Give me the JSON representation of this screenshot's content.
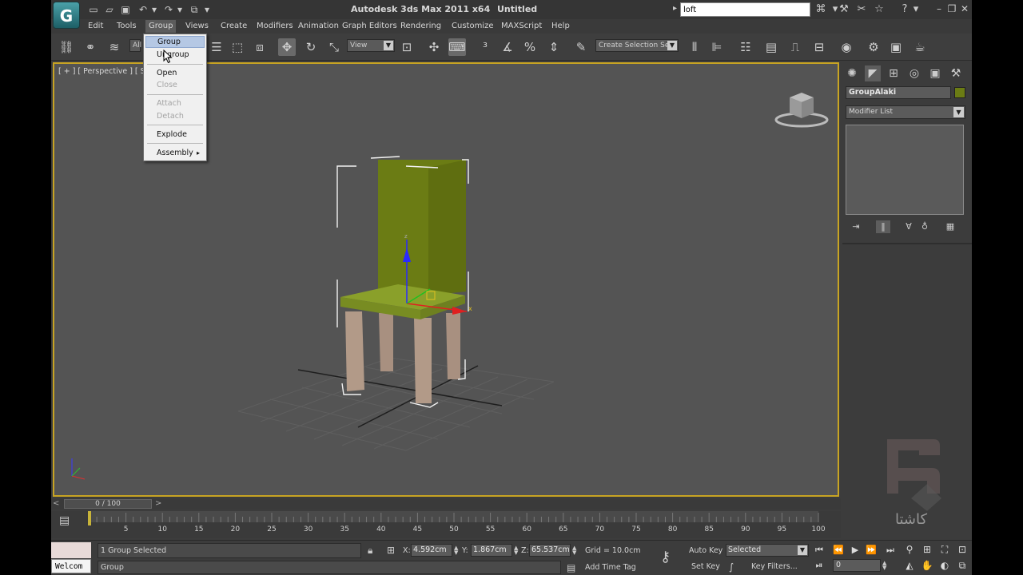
{
  "title_bar": {
    "app_title": "Autodesk 3ds Max  2011 x64",
    "doc_title": "Untitled",
    "search_value": "loft",
    "logo_letter": "G"
  },
  "menu": {
    "items": [
      "Edit",
      "Tools",
      "Group",
      "Views",
      "Create",
      "Modifiers",
      "Animation",
      "Graph Editors",
      "Rendering",
      "Customize",
      "MAXScript",
      "Help"
    ],
    "active": "Group"
  },
  "group_menu": {
    "items": [
      {
        "label": "Group",
        "state": "hover"
      },
      {
        "label": "Ungroup",
        "state": "normal"
      },
      {
        "label": "Open",
        "state": "normal"
      },
      {
        "label": "Close",
        "state": "disabled"
      },
      {
        "label": "Attach",
        "state": "disabled"
      },
      {
        "label": "Detach",
        "state": "disabled"
      },
      {
        "label": "Explode",
        "state": "normal"
      },
      {
        "label": "Assembly",
        "state": "normal",
        "submenu": true
      }
    ],
    "submenu_arrow": "▸"
  },
  "toolbar": {
    "selection_filter": "All",
    "reference_coord": "View",
    "named_selection": "Create Selection Se"
  },
  "viewport": {
    "label": "[ + ] [ Perspective ] [ Smo",
    "border_color": "#c8a423",
    "chair_back_color": "#6b7c14",
    "chair_seat_color": "#8aa02a",
    "chair_leg_color": "#b29a88"
  },
  "command_panel": {
    "object_name": "GroupAlaki",
    "object_color": "#6b7c14",
    "modifier_list": "Modifier List"
  },
  "watermark": {
    "text": "کاشتا"
  },
  "time_slider": {
    "left_arrow": "<",
    "position": "0 / 100",
    "right_arrow": ">"
  },
  "track": {
    "start": 0,
    "end": 100,
    "labels": [
      "5",
      "10",
      "15",
      "20",
      "25",
      "30",
      "35",
      "40",
      "45",
      "50",
      "55",
      "60",
      "65",
      "70",
      "75",
      "80",
      "85",
      "90",
      "95",
      "100"
    ]
  },
  "status": {
    "welcome": "Welcom",
    "selection": "1 Group Selected",
    "prompt": "Group",
    "x_label": "X:",
    "x_value": "4.592cm",
    "y_label": "Y:",
    "y_value": "1.867cm",
    "z_label": "Z:",
    "z_value": "65.537cm",
    "grid": "Grid = 10.0cm",
    "add_time_tag": "Add Time Tag",
    "auto_key": "Auto Key",
    "set_key": "Set Key",
    "key_mode": "Selected",
    "key_filters": "Key Filters...",
    "frame": "0"
  }
}
